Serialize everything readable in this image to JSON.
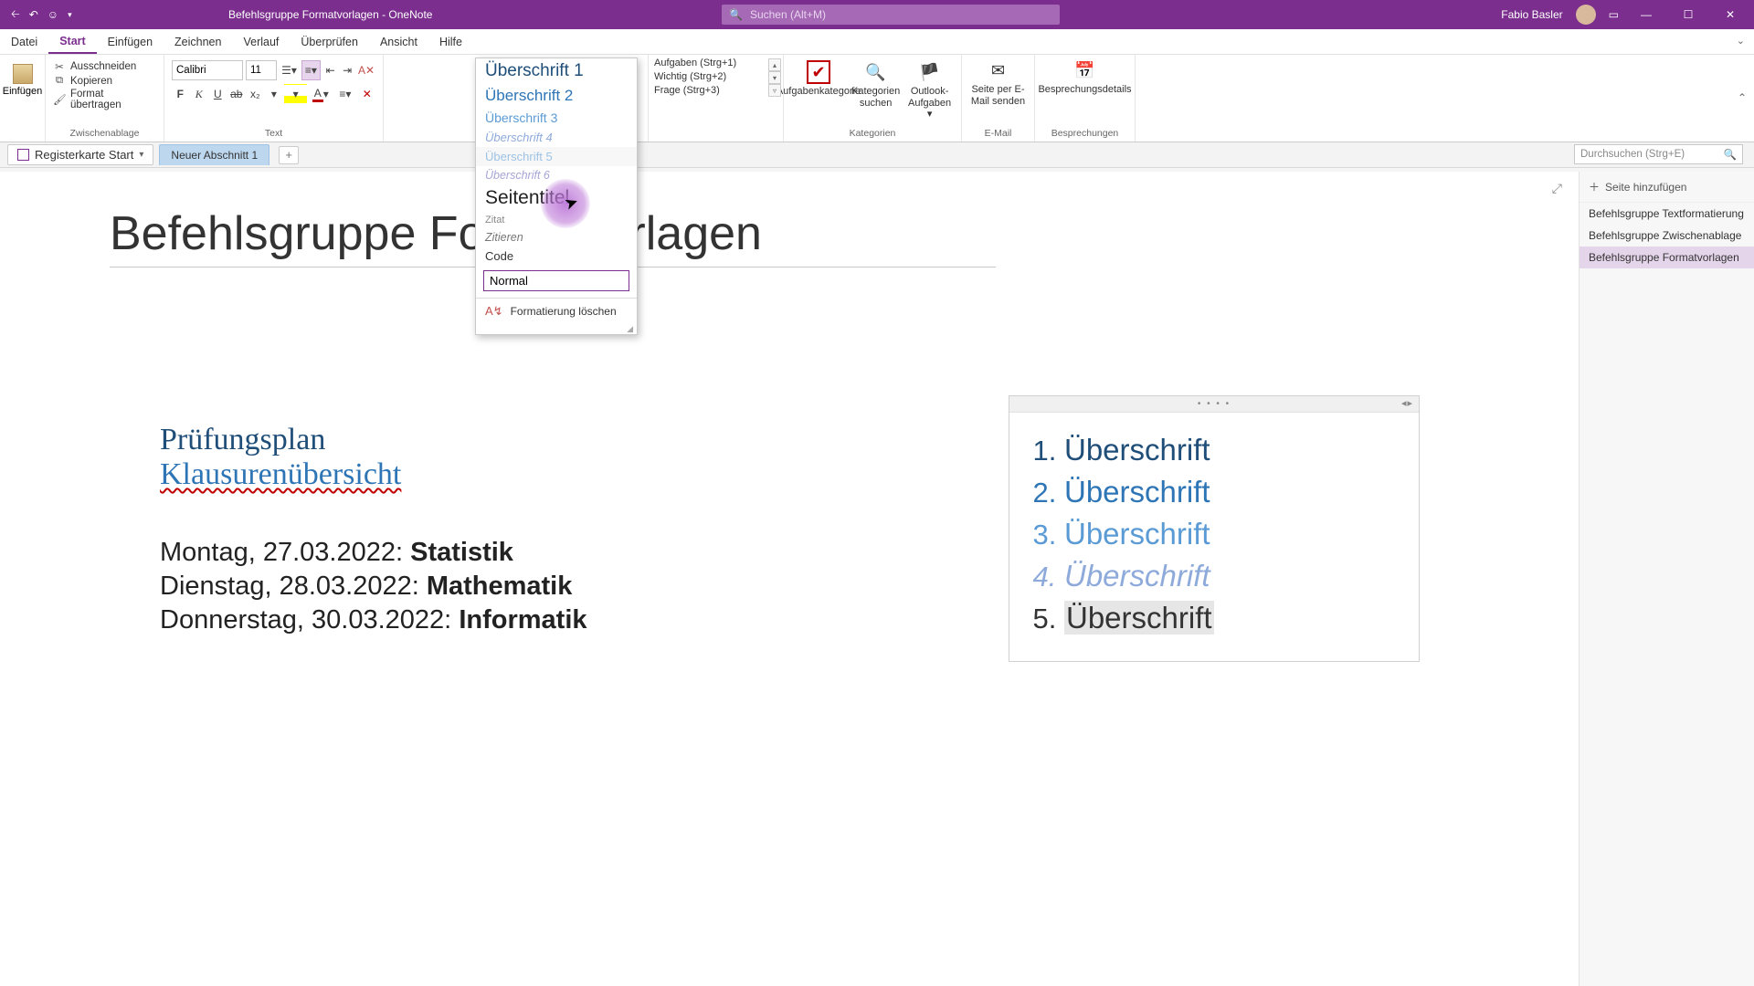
{
  "titlebar": {
    "doc_title": "Befehlsgruppe Formatvorlagen  -  OneNote",
    "search_placeholder": "Suchen (Alt+M)",
    "user": "Fabio Basler"
  },
  "menu": {
    "items": [
      "Datei",
      "Start",
      "Einfügen",
      "Zeichnen",
      "Verlauf",
      "Überprüfen",
      "Ansicht",
      "Hilfe"
    ],
    "active_index": 1
  },
  "ribbon": {
    "undo_label": "Einfügen",
    "clipboard": {
      "cut": "Ausschneiden",
      "copy": "Kopieren",
      "painter": "Format übertragen",
      "group": "Zwischenablage"
    },
    "text": {
      "font": "Calibri",
      "size": "11",
      "group": "Text"
    },
    "tags": {
      "items": [
        "Aufgaben (Strg+1)",
        "Wichtig (Strg+2)",
        "Frage (Strg+3)"
      ],
      "btn1": "Aufgabenkategorie",
      "btn2": "Kategorien suchen",
      "btn3": "Outlook-Aufgaben ▾",
      "group": "Kategorien"
    },
    "email": {
      "btn": "Seite per E-Mail senden",
      "group": "E-Mail"
    },
    "meet": {
      "btn": "Besprechungsdetails",
      "group": "Besprechungen"
    }
  },
  "styles": {
    "h1": "Überschrift 1",
    "h2": "Überschrift 2",
    "h3": "Überschrift 3",
    "h4": "Überschrift 4",
    "h5": "Überschrift 5",
    "h6": "Überschrift 6",
    "pagetitle": "Seitentitel",
    "quote": "Zitat",
    "quote2": "Zitieren",
    "code": "Code",
    "normal": "Normal",
    "clear": "Formatierung löschen"
  },
  "tabs": {
    "notebook": "Registerkarte Start",
    "section": "Neuer Abschnitt 1",
    "search_ph": "Durchsuchen (Strg+E)"
  },
  "page": {
    "title": "Befehlsgruppe Formatvorlagen",
    "note1": {
      "l1": "Prüfungsplan",
      "l2": "Klausurenübersicht",
      "l3a": "Montag, 27.03.2022: ",
      "l3b": "Statistik",
      "l4a": "Dienstag, 28.03.2022: ",
      "l4b": "Mathematik",
      "l5a": "Donnerstag, 30.03.2022: ",
      "l5b": "Informatik"
    },
    "note2": {
      "items": [
        "Überschrift",
        "Überschrift",
        "Überschrift",
        "Überschrift",
        "Überschrift"
      ]
    }
  },
  "pagepanel": {
    "add": "Seite hinzufügen",
    "items": [
      "Befehlsgruppe Textformatierung",
      "Befehlsgruppe Zwischenablage",
      "Befehlsgruppe Formatvorlagen"
    ],
    "selected": 2
  }
}
